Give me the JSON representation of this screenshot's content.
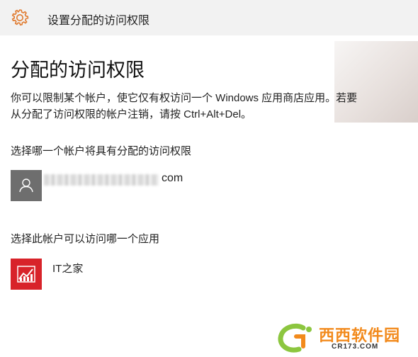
{
  "window": {
    "title": "设置分配的访问权限",
    "icon": "gear-icon"
  },
  "page": {
    "title": "分配的访问权限",
    "description": "你可以限制某个帐户，使它仅有权访问一个 Windows 应用商店应用。若要从分配了访问权限的帐户注销，请按 Ctrl+Alt+Del。"
  },
  "account_section": {
    "label": "选择哪一个帐户将具有分配的访问权限",
    "account_email_visible": "com",
    "avatar_icon": "person-icon"
  },
  "app_section": {
    "label": "选择此帐户可以访问哪一个应用",
    "app_name": "IT之家",
    "app_icon": "ithome-app-icon"
  },
  "watermark": {
    "text": "西西软件园",
    "url": "CR173.COM"
  },
  "colors": {
    "accent": "#f28a1c",
    "titlebar_bg": "#f2f2f2",
    "avatar_bg": "#6e6e6e",
    "app_tile_bg": "#d8232a"
  }
}
